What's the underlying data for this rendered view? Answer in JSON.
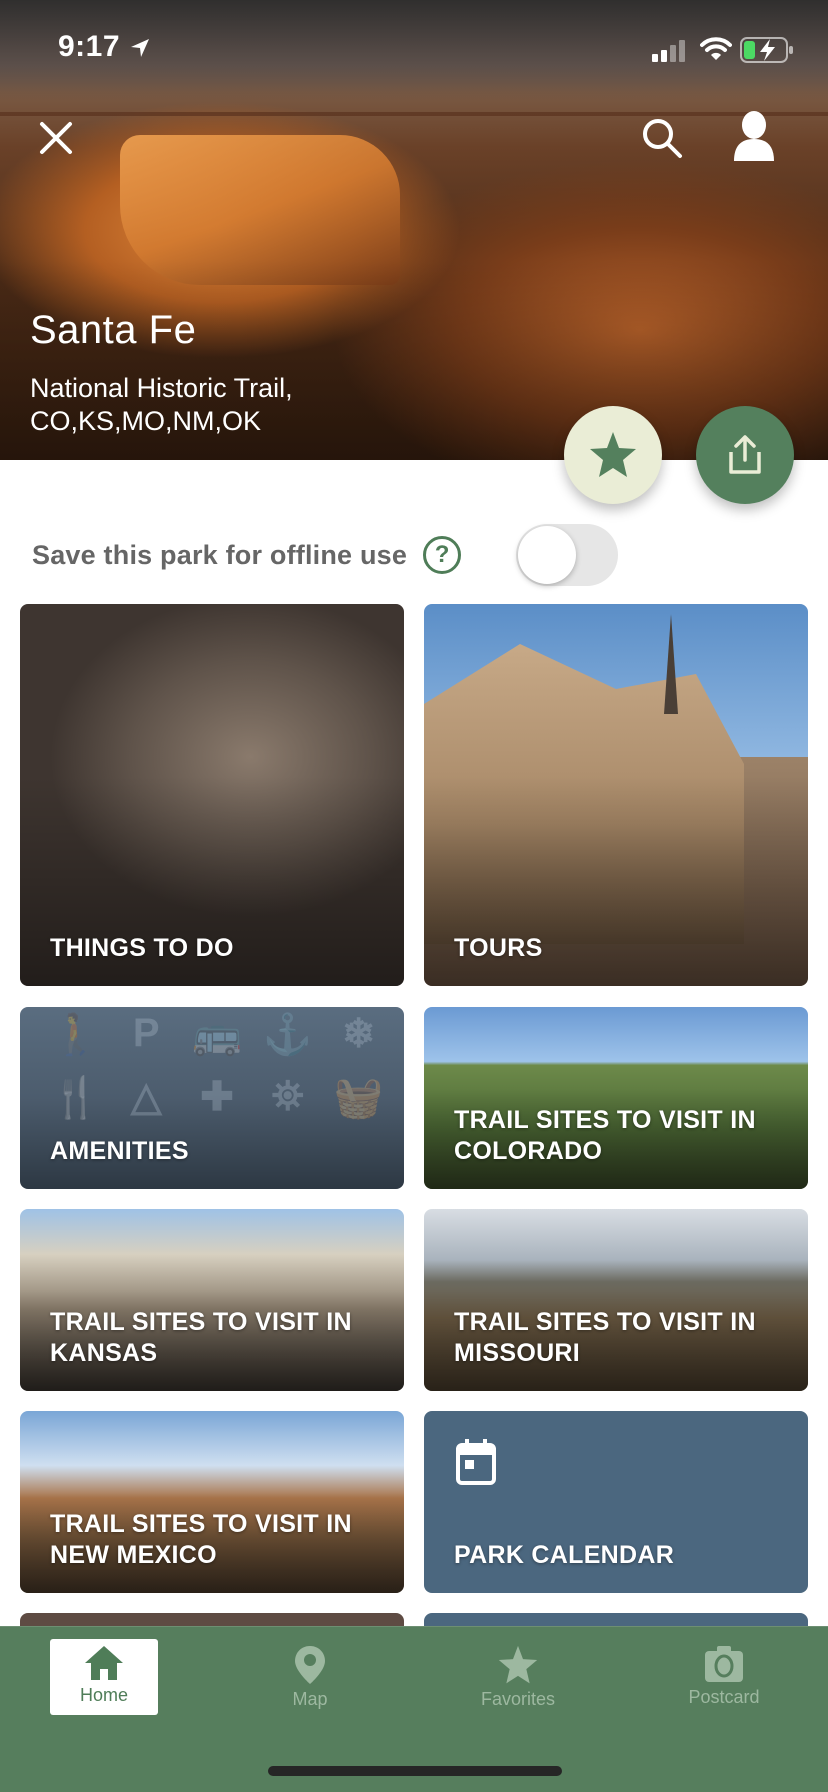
{
  "status_bar": {
    "time": "9:17",
    "location_icon": "location-arrow-icon",
    "signal_icon": "cellular-signal-icon",
    "wifi_icon": "wifi-icon",
    "battery_icon": "battery-charging-icon",
    "battery_color": "#4cd964"
  },
  "header": {
    "close_icon": "close-icon",
    "search_icon": "search-icon",
    "profile_icon": "profile-icon",
    "park_title": "Santa Fe",
    "park_subtitle_line1": "National Historic Trail,",
    "park_subtitle_line2": "CO,KS,MO,NM,OK",
    "favorite_icon": "star-icon",
    "share_icon": "share-icon"
  },
  "offline": {
    "label": "Save this park for offline use",
    "help_glyph": "?",
    "toggle_on": false
  },
  "tiles": [
    {
      "label": "THINGS TO DO"
    },
    {
      "label": "TOURS"
    },
    {
      "label": "AMENITIES",
      "icons": [
        "🚶",
        "P",
        "🚌",
        "⚓",
        "❄",
        "🍴",
        "△",
        "✚",
        "⛯",
        "🧺"
      ]
    },
    {
      "label": "TRAIL SITES TO VISIT IN COLORADO"
    },
    {
      "label": "TRAIL SITES TO VISIT IN KANSAS"
    },
    {
      "label": "TRAIL SITES TO VISIT IN MISSOURI"
    },
    {
      "label": "TRAIL SITES TO VISIT IN NEW MEXICO"
    },
    {
      "label": "PARK CALENDAR",
      "icon": "calendar-icon"
    }
  ],
  "tab_bar": {
    "tabs": [
      {
        "label": "Home",
        "icon": "home-icon",
        "active": true
      },
      {
        "label": "Map",
        "icon": "map-pin-icon",
        "active": false
      },
      {
        "label": "Favorites",
        "icon": "star-icon",
        "active": false
      },
      {
        "label": "Postcard",
        "icon": "camera-icon",
        "active": false
      }
    ]
  },
  "colors": {
    "brand_green": "#567e5d",
    "fab_favorite_bg": "#eaedd6",
    "tile_blue": "#4b677f",
    "offline_label": "#666666"
  }
}
